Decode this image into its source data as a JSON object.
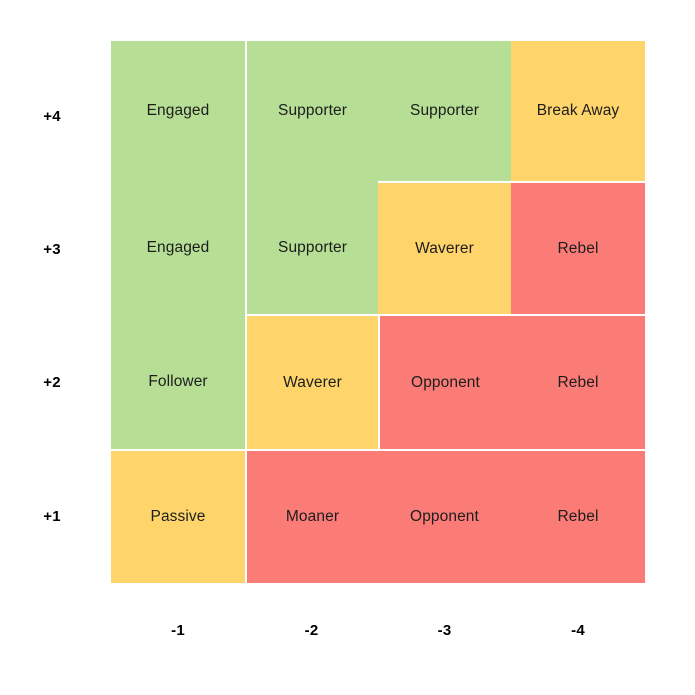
{
  "chart_data": {
    "type": "heatmap",
    "title": "",
    "xlabel": "",
    "ylabel": "",
    "grid": false,
    "legend": "none",
    "x_tick_labels": [
      "-1",
      "-2",
      "-3",
      "-4"
    ],
    "y_tick_labels": [
      "+4",
      "+3",
      "+2",
      "+1"
    ],
    "palette": {
      "green": "#b6de94",
      "yellow": "#ffd56b",
      "red": "#fb7c76",
      "background": "#ffffff",
      "text": "#1d1d1d",
      "tick_text": "#000000"
    },
    "categories": [
      "-1",
      "-2",
      "-3",
      "-4"
    ],
    "rows": [
      {
        "y": "+4",
        "cells": [
          {
            "x": "-1",
            "label": "Engaged",
            "color": "green"
          },
          {
            "x": "-2",
            "label": "Supporter",
            "color": "green"
          },
          {
            "x": "-3",
            "label": "Supporter",
            "color": "green"
          },
          {
            "x": "-4",
            "label": "Break Away",
            "color": "yellow"
          }
        ]
      },
      {
        "y": "+3",
        "cells": [
          {
            "x": "-1",
            "label": "Engaged",
            "color": "green"
          },
          {
            "x": "-2",
            "label": "Supporter",
            "color": "green"
          },
          {
            "x": "-3",
            "label": "Waverer",
            "color": "yellow"
          },
          {
            "x": "-4",
            "label": "Rebel",
            "color": "red"
          }
        ]
      },
      {
        "y": "+2",
        "cells": [
          {
            "x": "-1",
            "label": "Follower",
            "color": "green"
          },
          {
            "x": "-2",
            "label": "Waverer",
            "color": "yellow"
          },
          {
            "x": "-3",
            "label": "Opponent",
            "color": "red"
          },
          {
            "x": "-4",
            "label": "Rebel",
            "color": "red"
          }
        ]
      },
      {
        "y": "+1",
        "cells": [
          {
            "x": "-1",
            "label": "Passive",
            "color": "yellow"
          },
          {
            "x": "-2",
            "label": "Moaner",
            "color": "red"
          },
          {
            "x": "-3",
            "label": "Opponent",
            "color": "red"
          },
          {
            "x": "-4",
            "label": "Rebel",
            "color": "red"
          }
        ]
      }
    ]
  }
}
